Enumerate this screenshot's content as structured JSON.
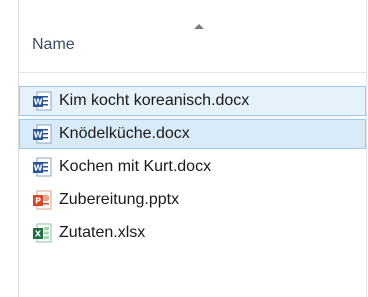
{
  "header": {
    "column_name": "Name",
    "sort_direction": "ascending"
  },
  "files": [
    {
      "name": "Kim kocht koreanisch.docx",
      "icon": "word-document-icon",
      "type": "docx",
      "state": "selected"
    },
    {
      "name": "Knödelküche.docx",
      "icon": "word-document-icon",
      "type": "docx",
      "state": "hovered"
    },
    {
      "name": "Kochen mit Kurt.docx",
      "icon": "word-document-icon",
      "type": "docx",
      "state": "normal"
    },
    {
      "name": "Zubereitung.pptx",
      "icon": "powerpoint-document-icon",
      "type": "pptx",
      "state": "normal"
    },
    {
      "name": "Zutaten.xlsx",
      "icon": "excel-document-icon",
      "type": "xlsx",
      "state": "normal"
    }
  ],
  "colors": {
    "word": "#2b5797",
    "powerpoint": "#d24726",
    "excel": "#1e7145",
    "selection": "#e5f1fb",
    "hover": "#d9ebf9",
    "selection_border": "#99c9ef"
  }
}
